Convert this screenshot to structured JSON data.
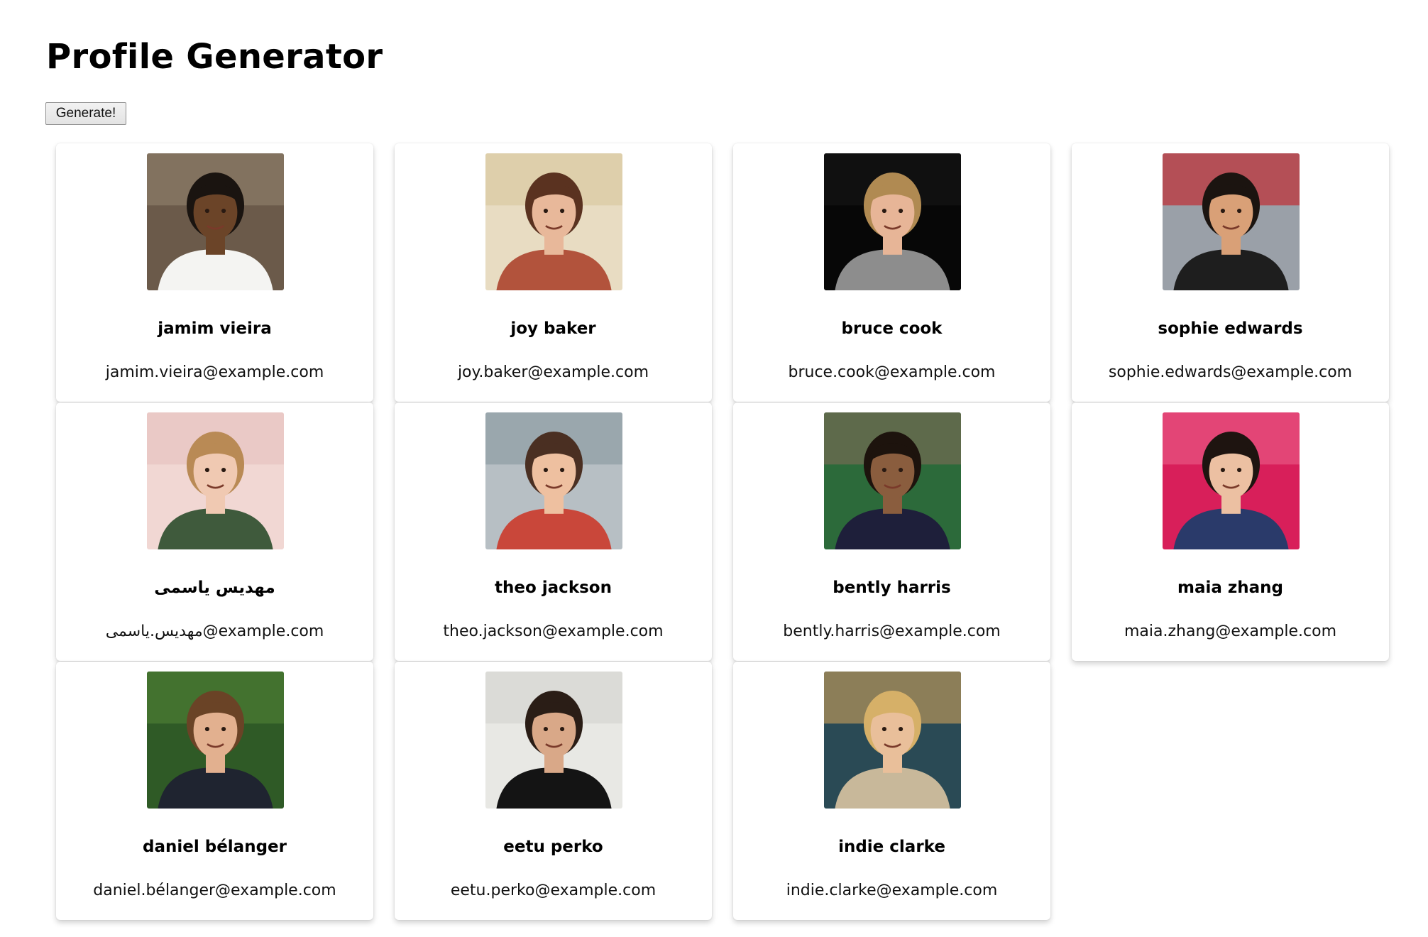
{
  "page": {
    "title": "Profile Generator",
    "generate_label": "Generate!"
  },
  "profiles": [
    {
      "name": "jamim vieira",
      "email": "jamim.vieira@example.com",
      "photo": {
        "bg": "#6b5a4a",
        "accent": "#8f7f6a",
        "skin": "#6b4428",
        "hair": "#1a1410",
        "shirt": "#f4f4f2"
      }
    },
    {
      "name": "joy baker",
      "email": "joy.baker@example.com",
      "photo": {
        "bg": "#e8dcc2",
        "accent": "#d9c89e",
        "skin": "#e8b89a",
        "hair": "#5a3220",
        "shirt": "#b2533c"
      }
    },
    {
      "name": "bruce cook",
      "email": "bruce.cook@example.com",
      "photo": {
        "bg": "#070707",
        "accent": "#151515",
        "skin": "#e7b597",
        "hair": "#b08a52",
        "shirt": "#8d8d8d"
      }
    },
    {
      "name": "sophie edwards",
      "email": "sophie.edwards@example.com",
      "photo": {
        "bg": "#9aa0a8",
        "accent": "#c2242a",
        "skin": "#d9a077",
        "hair": "#1b1410",
        "shirt": "#1e1e1e"
      }
    },
    {
      "name": "مهديس ياسمی",
      "email": "مهديس.ياسمی@example.com",
      "photo": {
        "bg": "#f1d7d3",
        "accent": "#e6c1bf",
        "skin": "#f0c9b2",
        "hair": "#b98a55",
        "shirt": "#3f5a3c"
      }
    },
    {
      "name": "theo jackson",
      "email": "theo.jackson@example.com",
      "photo": {
        "bg": "#b7bfc4",
        "accent": "#8b9aa2",
        "skin": "#eec0a0",
        "hair": "#4a2f22",
        "shirt": "#c9473a"
      }
    },
    {
      "name": "bently harris",
      "email": "bently.harris@example.com",
      "photo": {
        "bg": "#2c6a3a",
        "accent": "#7a6a55",
        "skin": "#8a5d3e",
        "hair": "#1d130d",
        "shirt": "#1e1f3a"
      }
    },
    {
      "name": "maia zhang",
      "email": "maia.zhang@example.com",
      "photo": {
        "bg": "#d81f5a",
        "accent": "#ea5a86",
        "skin": "#ecc0a2",
        "hair": "#1e1410",
        "shirt": "#2a3a6a"
      }
    },
    {
      "name": "daniel bélanger",
      "email": "daniel.bélanger@example.com",
      "photo": {
        "bg": "#2f5a26",
        "accent": "#4e7f34",
        "skin": "#e2b08f",
        "hair": "#6a4326",
        "shirt": "#1f2430"
      }
    },
    {
      "name": "eetu perko",
      "email": "eetu.perko@example.com",
      "photo": {
        "bg": "#e8e8e4",
        "accent": "#d4d4cf",
        "skin": "#d9a888",
        "hair": "#2a1d16",
        "shirt": "#141414"
      }
    },
    {
      "name": "indie clarke",
      "email": "indie.clarke@example.com",
      "photo": {
        "bg": "#2a4a55",
        "accent": "#c29a5a",
        "skin": "#e9bf9a",
        "hair": "#d6b068",
        "shirt": "#c8b89a"
      }
    }
  ]
}
